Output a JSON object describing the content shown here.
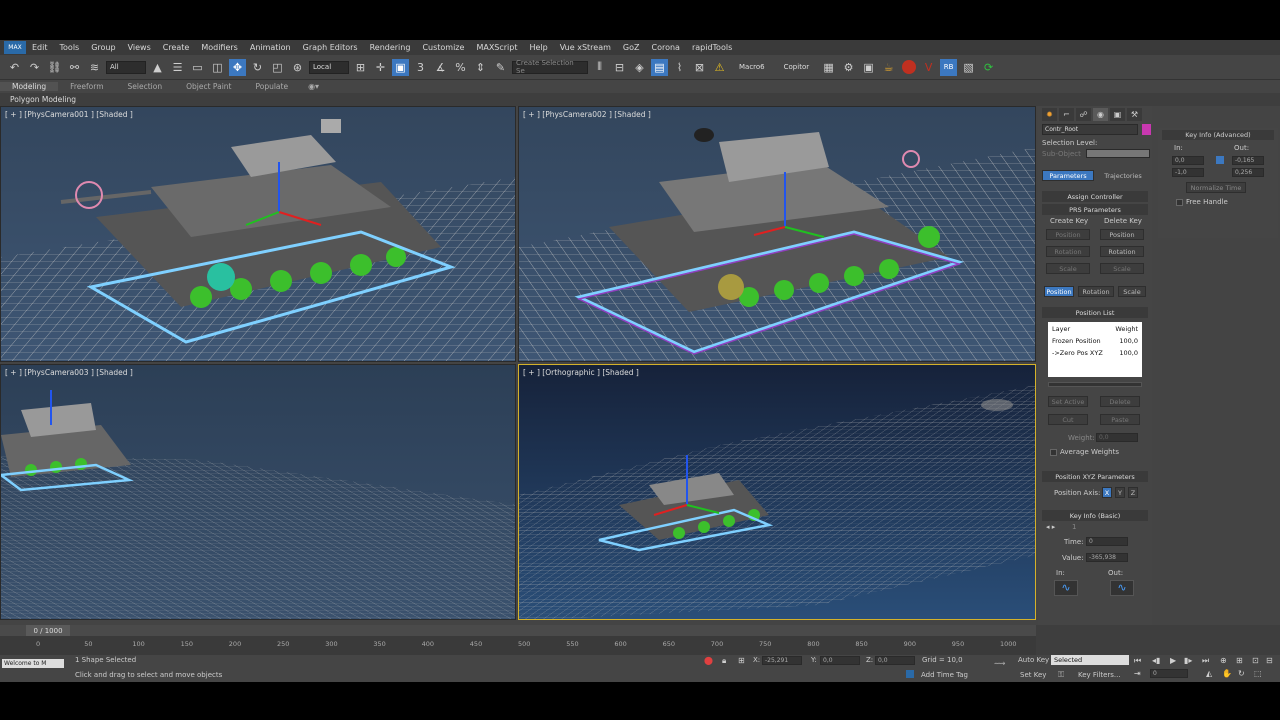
{
  "menu": [
    "Edit",
    "Tools",
    "Group",
    "Views",
    "Create",
    "Modifiers",
    "Animation",
    "Graph Editors",
    "Rendering",
    "Customize",
    "MAXScript",
    "Help",
    "Vue xStream",
    "GoZ",
    "Corona",
    "rapidTools"
  ],
  "logo": "MAX",
  "toolbar": {
    "selection_filter": "All",
    "ref_coord": "Local",
    "named_selection": "Create Selection Se",
    "macro_label": "Macro6",
    "copitor_label": "Copitor",
    "rb_label": "RB"
  },
  "ribbon": {
    "tabs": [
      "Modeling",
      "Freeform",
      "Selection",
      "Object Paint",
      "Populate"
    ],
    "sub_label": "Polygon Modeling"
  },
  "viewports": {
    "tl": "[ + ] [PhysCamera001 ] [Shaded ]",
    "tr": "[ + ] [PhysCamera002 ] [Shaded ]",
    "bl": "[ + ] [PhysCamera003 ] [Shaded ]",
    "br": "[ + ] [Orthographic ] [Shaded ]"
  },
  "command_panel": {
    "object_name": "Contr_Root",
    "selection_level": "Selection Level:",
    "sub_object": "Sub-Object",
    "tab_parameters": "Parameters",
    "tab_trajectories": "Trajectories",
    "assign_controller": "Assign Controller",
    "prs_parameters": "PRS Parameters",
    "create_key": "Create Key",
    "delete_key": "Delete Key",
    "position": "Position",
    "rotation": "Rotation",
    "scale": "Scale",
    "position_list": "Position List",
    "list_header_layer": "Layer",
    "list_header_weight": "Weight",
    "list_rows": [
      {
        "layer": "Frozen Position",
        "weight": "100,0"
      },
      {
        "layer": "->Zero Pos XYZ",
        "weight": "100,0"
      }
    ],
    "set_active": "Set Active",
    "delete": "Delete",
    "cut": "Cut",
    "paste": "Paste",
    "weight_label": "Weight:",
    "weight_value": "0,0",
    "average_weights": "Average Weights",
    "pos_xyz_params": "Position XYZ Parameters",
    "position_axis": "Position Axis:",
    "axis_x": "X",
    "axis_y": "Y",
    "axis_z": "Z",
    "key_info_basic": "Key Info (Basic)",
    "key_number": "1",
    "time_label": "Time:",
    "time_value": "0",
    "value_label": "Value:",
    "value_value": "-365,938",
    "in_label": "In:",
    "out_label": "Out:"
  },
  "key_info_advanced": {
    "title": "Key Info (Advanced)",
    "in_label": "In:",
    "out_label": "Out:",
    "in_value1": "0,0",
    "in_value2": "-1,0",
    "out_value1": "-0,165",
    "out_value2": "0,256",
    "normalize_time": "Normalize Time",
    "free_handle": "Free Handle"
  },
  "timeline": {
    "slider_label": "0 / 1000",
    "ticks": [
      "0",
      "50",
      "100",
      "150",
      "200",
      "250",
      "300",
      "350",
      "400",
      "450",
      "500",
      "550",
      "600",
      "650",
      "700",
      "750",
      "800",
      "850",
      "900",
      "950",
      "1000"
    ]
  },
  "status": {
    "miniscript": "Welcome to M",
    "selected": "1 Shape Selected",
    "prompt": "Click and drag to select and move objects",
    "x_label": "X:",
    "x_value": "-25,291",
    "y_label": "Y:",
    "y_value": "0,0",
    "z_label": "Z:",
    "z_value": "0,0",
    "grid": "Grid = 10,0",
    "add_time_tag": "Add Time Tag",
    "auto_key": "Auto Key",
    "set_key": "Set Key",
    "selected_option": "Selected",
    "key_filters": "Key Filters...",
    "frame": "0"
  }
}
